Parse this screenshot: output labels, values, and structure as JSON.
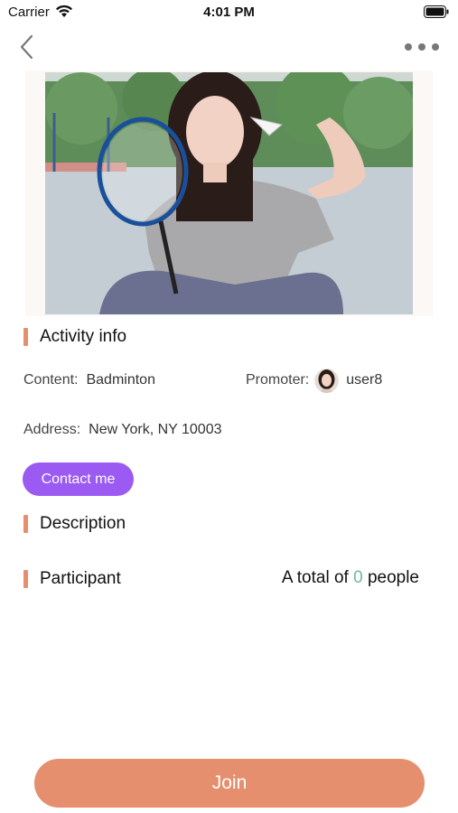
{
  "status_bar": {
    "carrier": "Carrier",
    "time": "4:01 PM"
  },
  "nav": {
    "back_icon": "chevron-left-icon",
    "more_icon": "ellipsis-icon"
  },
  "activity_info": {
    "title": "Activity info",
    "content_label": "Content:",
    "content_value": "Badminton",
    "promoter_label": "Promoter:",
    "promoter_name": "user8",
    "address_label": "Address:",
    "address_value": "New York, NY 10003"
  },
  "contact_button": "Contact me",
  "description": {
    "title": "Description"
  },
  "participant": {
    "title": "Participant",
    "total_prefix": "A total of",
    "count": "0",
    "total_suffix": "people"
  },
  "join_button": "Join",
  "colors": {
    "accent": "#e58f6e",
    "contact": "#9b5af2",
    "count": "#6fb89a"
  }
}
